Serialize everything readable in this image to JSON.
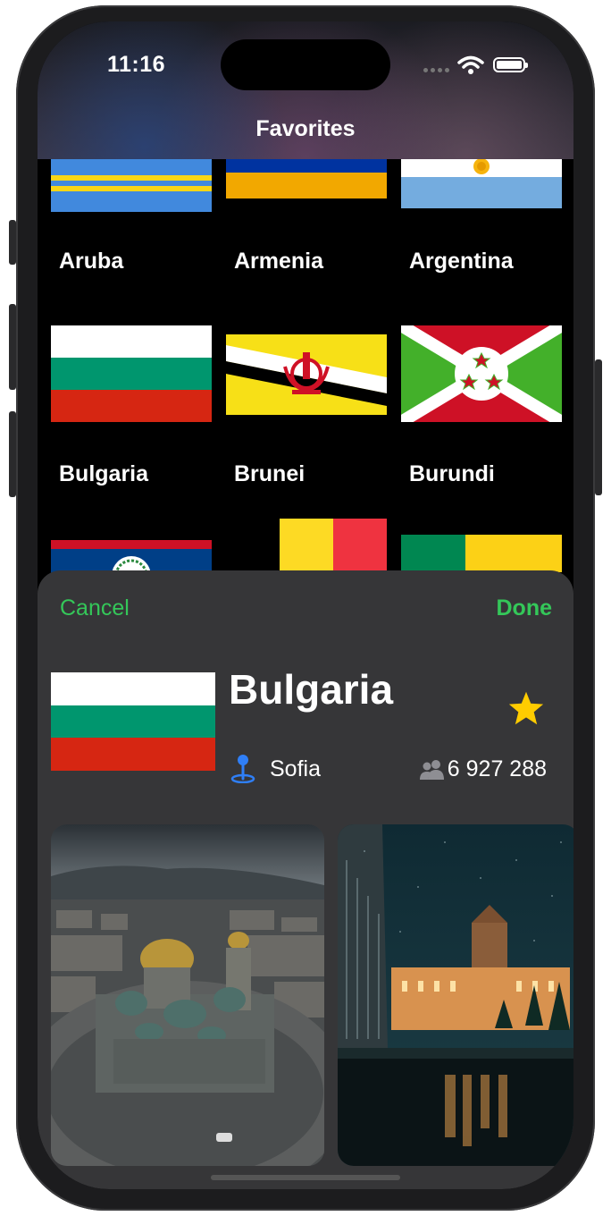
{
  "status": {
    "time": "11:16"
  },
  "nav": {
    "title": "Favorites"
  },
  "grid": {
    "row1": [
      "Aruba",
      "Armenia",
      "Argentina"
    ],
    "row2": [
      "Bulgaria",
      "Brunei",
      "Burundi"
    ]
  },
  "sheet": {
    "cancel_label": "Cancel",
    "done_label": "Done",
    "country": "Bulgaria",
    "capital": "Sofia",
    "population": "6 927 288",
    "favorite": true
  },
  "colors": {
    "accent_green": "#34c759",
    "star_yellow": "#ffcc00",
    "capital_pin_blue": "#2f7ff7",
    "sheet_bg": "#363638"
  },
  "icons": [
    "signal-dots-icon",
    "wifi-icon",
    "battery-icon",
    "star-icon",
    "map-pin-icon",
    "people-icon"
  ]
}
